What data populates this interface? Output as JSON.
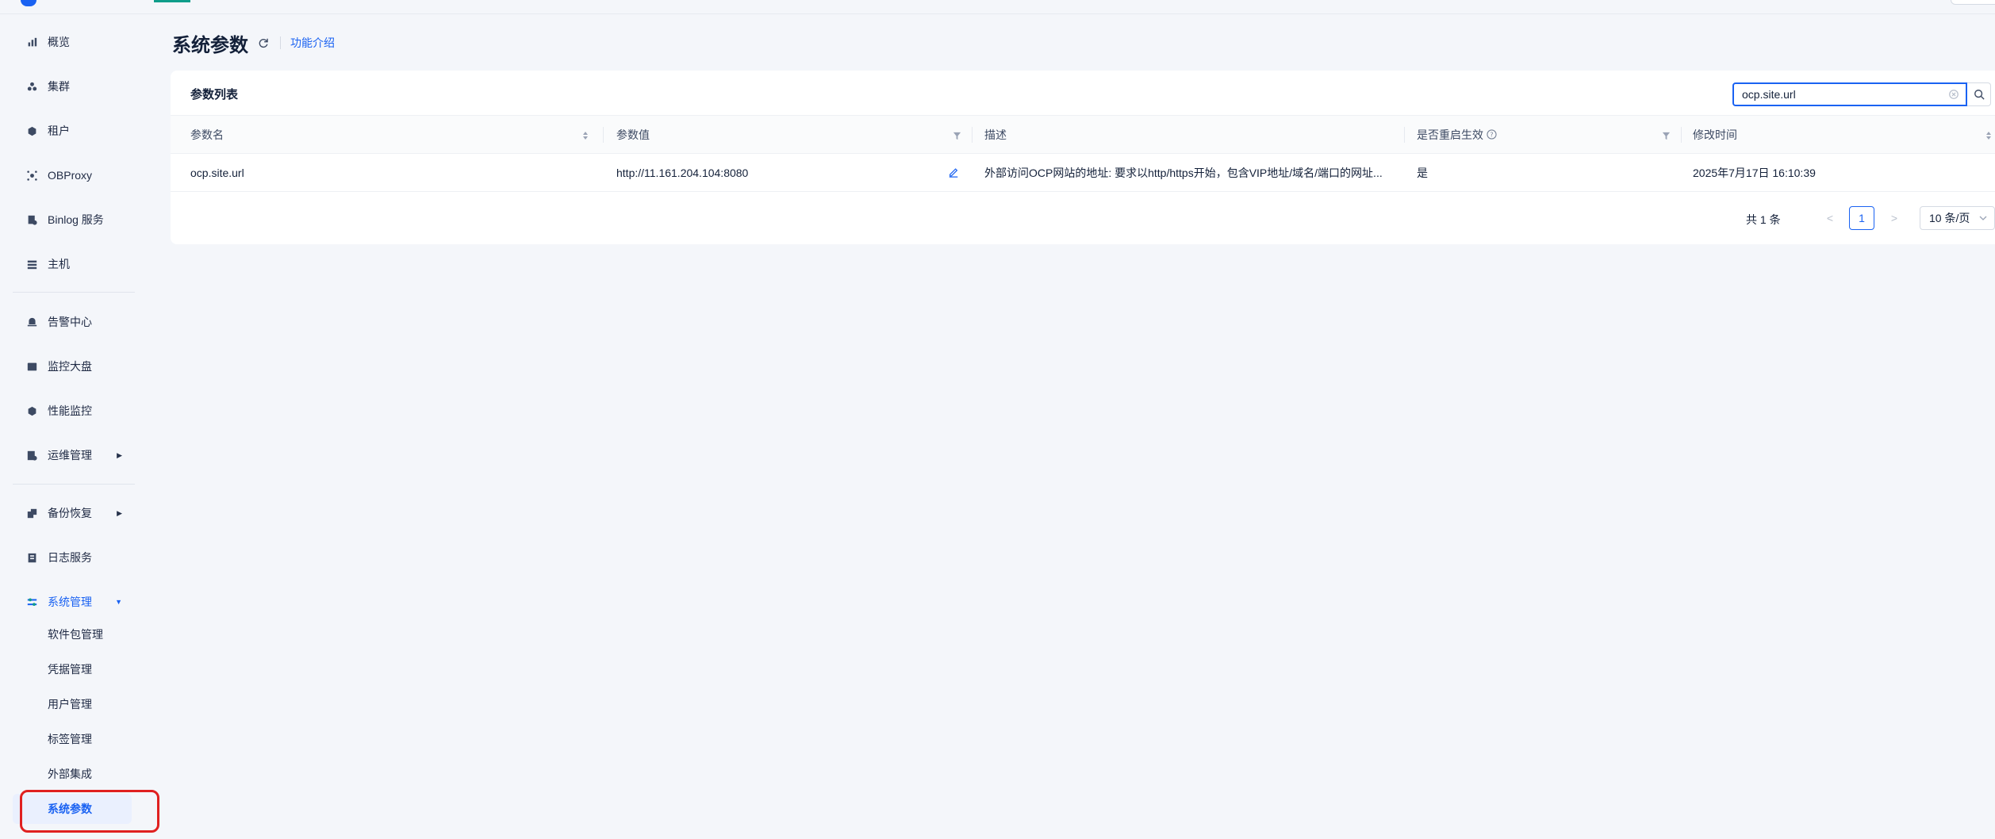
{
  "sidebar": {
    "items": [
      {
        "label": "概览",
        "icon": "chart-bar-icon"
      },
      {
        "label": "集群",
        "icon": "cluster-icon"
      },
      {
        "label": "租户",
        "icon": "tenant-icon"
      },
      {
        "label": "OBProxy",
        "icon": "proxy-icon"
      },
      {
        "label": "Binlog 服务",
        "icon": "binlog-icon"
      },
      {
        "label": "主机",
        "icon": "host-icon"
      },
      {
        "label": "告警中心",
        "icon": "alarm-icon"
      },
      {
        "label": "监控大盘",
        "icon": "dashboard-icon"
      },
      {
        "label": "性能监控",
        "icon": "performance-icon"
      },
      {
        "label": "运维管理",
        "icon": "ops-icon"
      },
      {
        "label": "备份恢复",
        "icon": "backup-icon"
      },
      {
        "label": "日志服务",
        "icon": "log-icon"
      },
      {
        "label": "系统管理",
        "icon": "settings-icon"
      }
    ],
    "sub_items": [
      "软件包管理",
      "凭据管理",
      "用户管理",
      "标签管理",
      "外部集成",
      "系统参数"
    ]
  },
  "header": {
    "title": "系统参数",
    "intro_link": "功能介绍"
  },
  "card": {
    "title": "参数列表",
    "search_value": "ocp.site.url"
  },
  "table": {
    "columns": [
      "参数名",
      "参数值",
      "描述",
      "是否重启生效",
      "修改时间"
    ],
    "rows": [
      {
        "name": "ocp.site.url",
        "value": "http://11.161.204.104:8080",
        "description": "外部访问OCP网站的地址: 要求以http/https开始，包含VIP地址/域名/端口的网址...",
        "restart": "是",
        "modified": "2025年7月17日 16:10:39"
      }
    ]
  },
  "pagination": {
    "total": "共 1 条",
    "current_page": "1",
    "page_size": "10 条/页",
    "prev": "<",
    "next": ">"
  },
  "colors": {
    "accent": "#1a62f2",
    "highlight": "#e02020"
  }
}
